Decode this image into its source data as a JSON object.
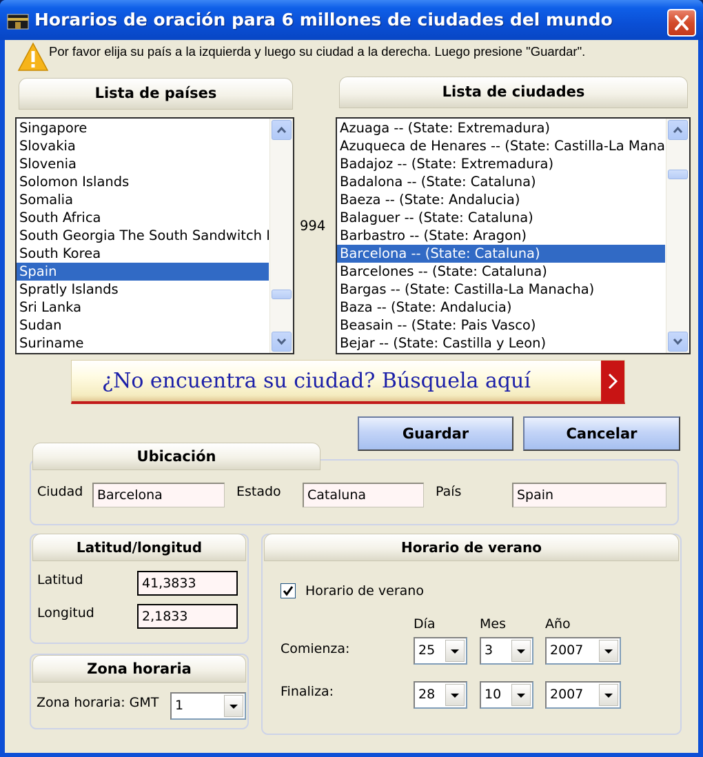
{
  "window": {
    "title": "Horarios de oración para 6 millones de ciudades del mundo"
  },
  "notice": {
    "text": "Por favor elija su país a la izquierda y luego su ciudad a la derecha. Luego presione \"Guardar\"."
  },
  "countries": {
    "header": "Lista de países",
    "items": [
      "Singapore",
      "Slovakia",
      "Slovenia",
      "Solomon Islands",
      "Somalia",
      "South Africa",
      "South Georgia The South Sandwitch Islands",
      "South Korea",
      "Spain",
      "Spratly Islands",
      "Sri Lanka",
      "Sudan",
      "Suriname"
    ],
    "selected": "Spain"
  },
  "city_count": "994",
  "cities": {
    "header": "Lista de ciudades",
    "items": [
      "Azuaga -- (State: Extremadura)",
      "Azuqueca de Henares -- (State: Castilla-La Manacha)",
      "Badajoz -- (State: Extremadura)",
      "Badalona -- (State: Cataluna)",
      "Baeza -- (State: Andalucia)",
      "Balaguer -- (State: Cataluna)",
      "Barbastro -- (State: Aragon)",
      "Barcelona -- (State: Cataluna)",
      "Barcelones -- (State: Cataluna)",
      "Bargas -- (State: Castilla-La Manacha)",
      "Baza -- (State: Andalucia)",
      "Beasain -- (State: Pais Vasco)",
      "Bejar -- (State: Castilla y Leon)"
    ],
    "selected": "Barcelona -- (State: Cataluna)"
  },
  "banner": {
    "text": "¿No encuentra su ciudad? Búsquela aquí"
  },
  "buttons": {
    "save": "Guardar",
    "cancel": "Cancelar"
  },
  "location": {
    "header": "Ubicación",
    "city_label": "Ciudad",
    "city_value": "Barcelona",
    "state_label": "Estado",
    "state_value": "Cataluna",
    "country_label": "País",
    "country_value": "Spain"
  },
  "latlong": {
    "header": "Latitud/longitud",
    "lat_label": "Latitud",
    "lat_value": "41,3833",
    "lon_label": "Longitud",
    "lon_value": "2,1833"
  },
  "timezone": {
    "header": "Zona horaria",
    "label": "Zona horaria: GMT",
    "value": "1"
  },
  "dst": {
    "header": "Horario de verano",
    "checkbox_label": "Horario de verano",
    "checked": true,
    "col_day": "Día",
    "col_month": "Mes",
    "col_year": "Año",
    "start_label": "Comienza:",
    "start_day": "25",
    "start_month": "3",
    "start_year": "2007",
    "end_label": "Finaliza:",
    "end_day": "28",
    "end_month": "10",
    "end_year": "2007"
  }
}
